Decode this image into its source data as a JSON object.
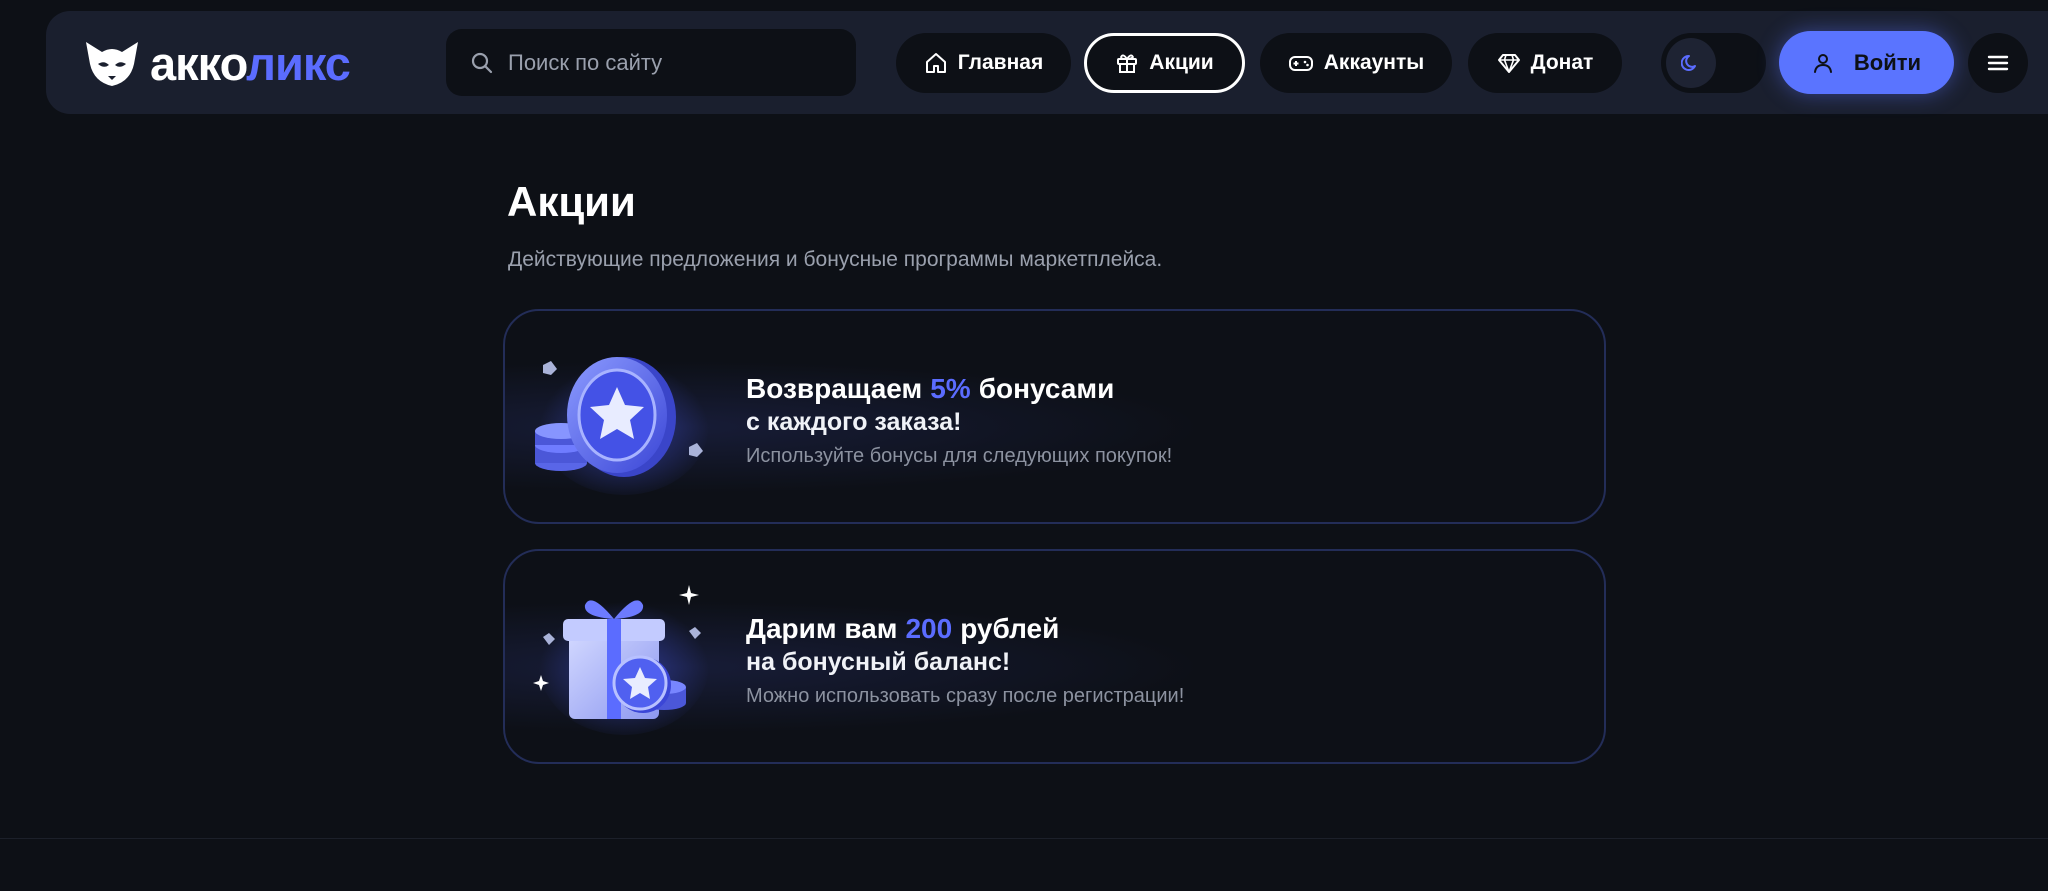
{
  "header": {
    "logo": {
      "part1": "акко",
      "part2": "ликс"
    },
    "search": {
      "placeholder": "Поиск по сайту"
    },
    "nav": [
      {
        "label": "Главная",
        "icon": "home-icon"
      },
      {
        "label": "Акции",
        "icon": "gift-icon",
        "active": true
      },
      {
        "label": "Аккаунты",
        "icon": "gamepad-icon"
      },
      {
        "label": "Донат",
        "icon": "diamond-icon"
      }
    ],
    "theme_toggle": {
      "icon": "moon-icon"
    },
    "login": {
      "label": "Войти",
      "icon": "user-icon"
    },
    "menu": {
      "icon": "menu-icon"
    }
  },
  "main": {
    "title": "Акции",
    "subtitle": "Действующие предложения и бонусные программы маркетплейса.",
    "promos": [
      {
        "head_before": "Возвращаем",
        "head_accent": "5%",
        "head_after": "бонусами",
        "line2": "с каждого заказа!",
        "desc": "Используйте бонусы для следующих покупок!",
        "art": "coin-star-icon"
      },
      {
        "head_before": "Дарим вам",
        "head_accent": "200",
        "head_after": "рублей",
        "line2": "на бонусный баланс!",
        "desc": "Можно использовать сразу после регистрации!",
        "art": "gift-box-icon"
      }
    ]
  },
  "colors": {
    "background": "#0d1016",
    "header": "#1a1f2e",
    "accent": "#5b6cff",
    "button": "#5a74ff",
    "muted_text": "#9aa0ad"
  }
}
